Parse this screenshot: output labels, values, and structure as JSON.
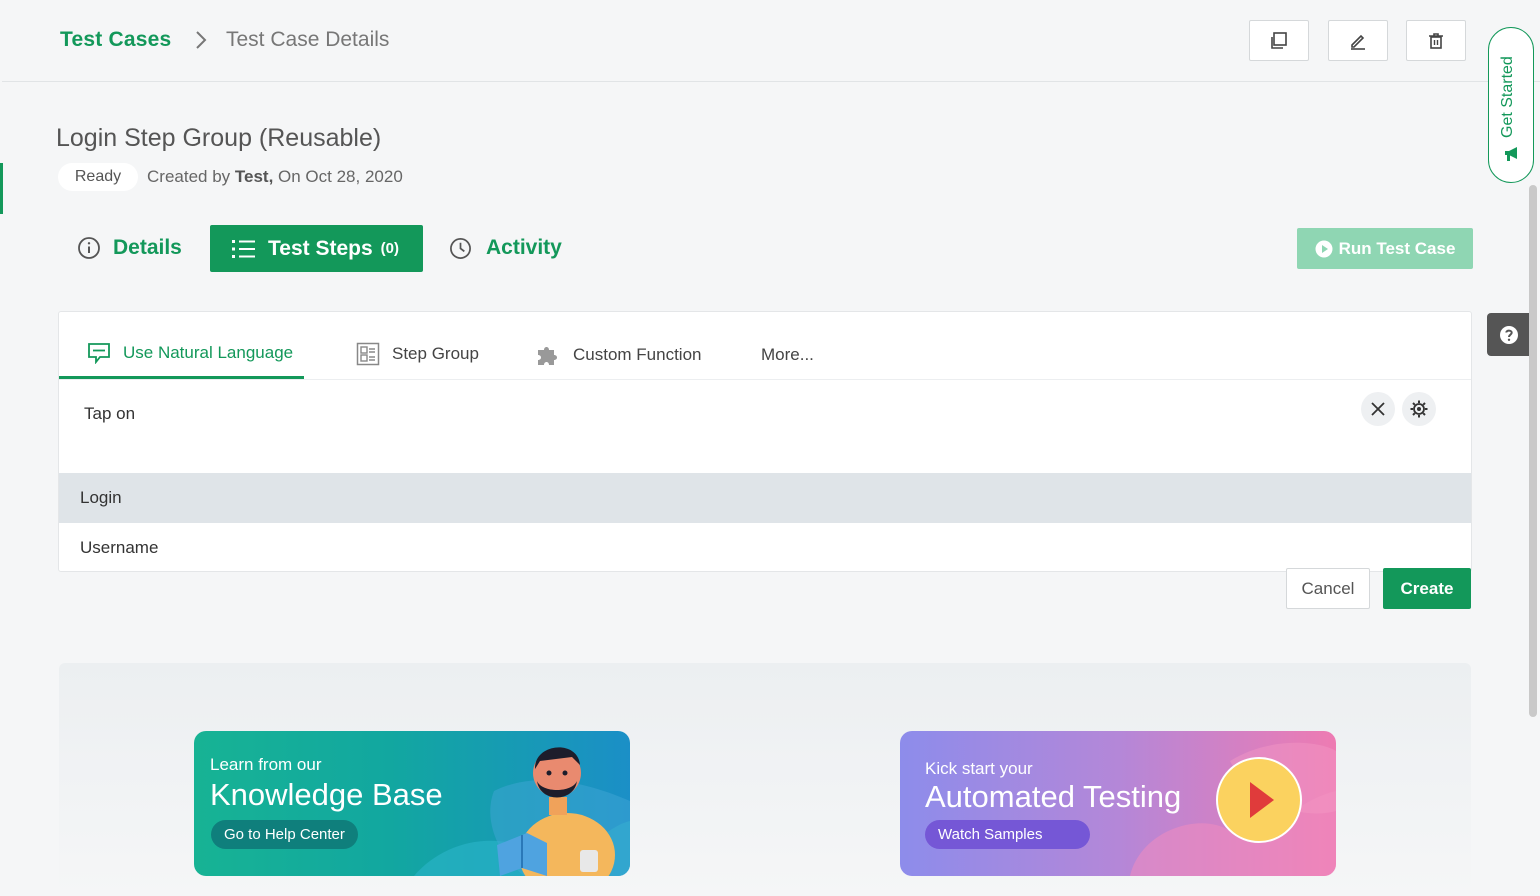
{
  "breadcrumb": {
    "root": "Test Cases",
    "current": "Test Case Details"
  },
  "header_actions": {
    "copy": "copy-icon",
    "edit": "pencil-icon",
    "delete": "trash-icon"
  },
  "test_case": {
    "title": "Login Step Group (Reusable)",
    "status": "Ready",
    "created_prefix": "Created by ",
    "created_by": "Test,",
    "created_on": " On Oct 28, 2020"
  },
  "tabs": {
    "details": "Details",
    "test_steps": "Test Steps",
    "test_steps_count": "(0)",
    "activity": "Activity"
  },
  "run_button": "Run Test Case",
  "get_started": "Get Started",
  "editor": {
    "subtabs": [
      "Use Natural Language",
      "Step Group",
      "Custom Function",
      "More..."
    ],
    "step_text": "Tap on",
    "suggestions": [
      "Login",
      "Username"
    ]
  },
  "actions": {
    "cancel": "Cancel",
    "create": "Create"
  },
  "promo": {
    "kb_small": "Learn from our",
    "kb_big": "Knowledge Base",
    "kb_button": "Go to Help Center",
    "at_small": "Kick start your",
    "at_big": "Automated Testing",
    "at_button": "Watch Samples"
  },
  "colors": {
    "brand": "#13985a",
    "run_disabled": "#8fd6b3",
    "highlight_row": "#dfe4e8"
  }
}
